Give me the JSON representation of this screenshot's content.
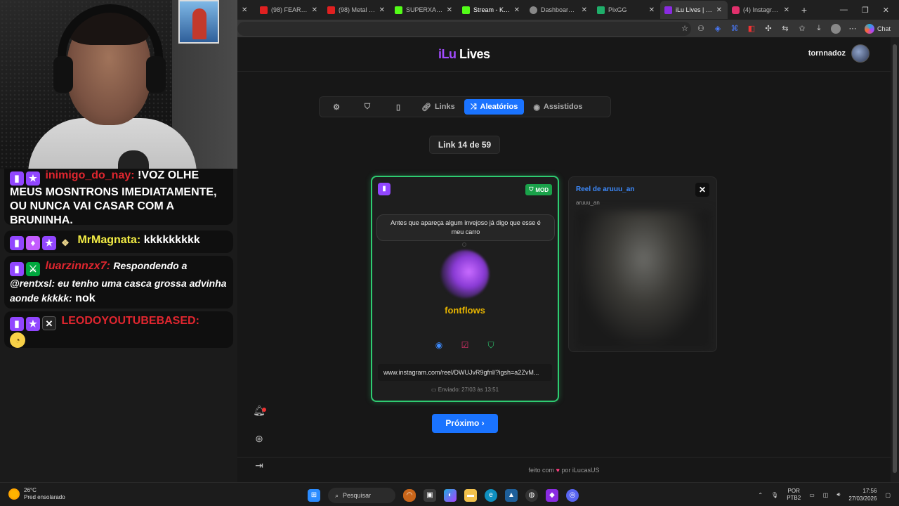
{
  "chat": {
    "messages": [
      {
        "user": "inimigo_do_nay:",
        "text": "!VOZ OLHE MEUS MOSNTRONS IMEDIATAMENTE, OU NUNCA VAI CASAR COM A BRUNINHA."
      },
      {
        "user": "MrMagnata:",
        "text": "kkkkkkkkk"
      },
      {
        "user": "luarzinnzx7:",
        "reply": "Respondendo a @rentxsl: eu tenho uma casca grossa advinha aonde kkkkk:",
        "text": "nok"
      },
      {
        "user": "LEODOYOUTUBEBASED:",
        "text": ""
      }
    ]
  },
  "browser": {
    "tabs": [
      {
        "label": "",
        "color": "#555555"
      },
      {
        "label": "(98) FEAR THE C",
        "color": "#e02020"
      },
      {
        "label": "(98) Metal Instru",
        "color": "#e02020"
      },
      {
        "label": "SUPERXANDAO",
        "color": "#53fc18"
      },
      {
        "label": "Stream - Kick Da",
        "color": "#53fc18"
      },
      {
        "label": "Dashboard - Liv",
        "color": "#888888"
      },
      {
        "label": "PixGG",
        "color": "#1fae6a"
      },
      {
        "label": "iLu Lives | React",
        "color": "#8a2be2"
      },
      {
        "label": "(4) Instagram",
        "color": "#e1306c"
      }
    ],
    "chat_label": "Chat"
  },
  "app": {
    "logo_prefix": "iLu",
    "logo_suffix": "Lives",
    "username": "tornnadoz",
    "tabs": {
      "links": "Links",
      "random": "Aleatórios",
      "watched": "Assistidos"
    },
    "counter": "Link 14 de 59",
    "card": {
      "badge": "MOD",
      "message": "Antes que apareça algum invejoso já digo que esse é meu carro",
      "name": "fontflows",
      "link": "www.instagram.com/reel/DWUJvR9gfnl/?igsh=a2ZvM...",
      "sent": "Enviado: 27/03 às 13:51"
    },
    "preview": {
      "title": "Reel de aruuu_an",
      "subtitle": "aruuu_an"
    },
    "next_button": "Próximo ›",
    "footer_before": "feito com",
    "footer_after": "por iLucasUS"
  },
  "taskbar": {
    "temperature": "26°C",
    "weather": "Pred ensolarado",
    "search": "Pesquisar",
    "lang1": "POR",
    "lang2": "PTB2",
    "time": "17:56",
    "date": "27/03/2026"
  }
}
